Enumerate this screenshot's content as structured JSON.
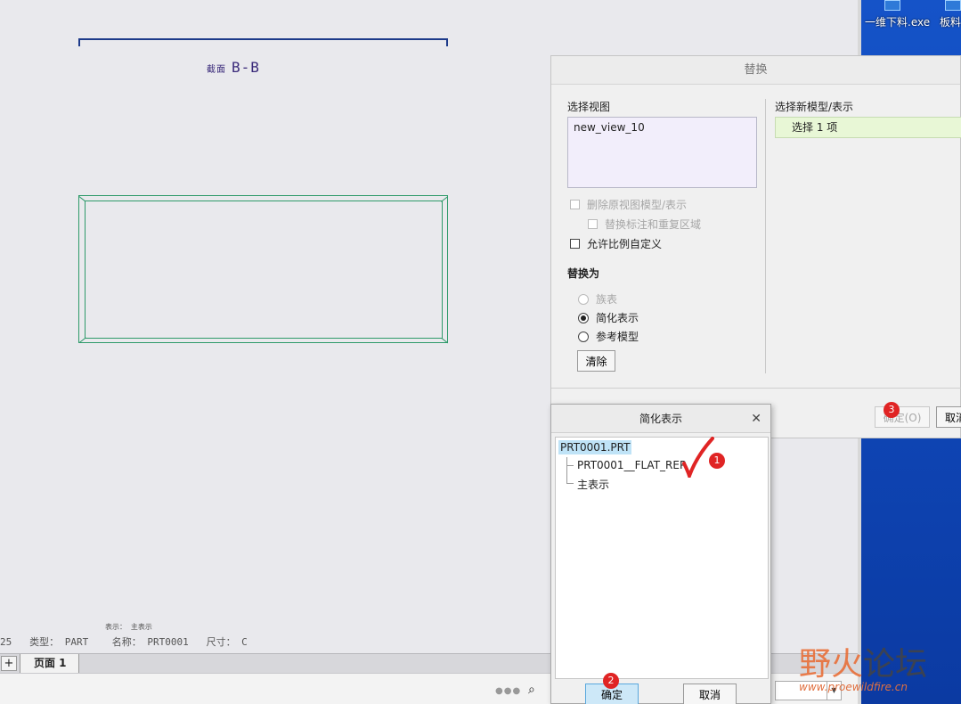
{
  "drawing": {
    "section_prefix": "截面",
    "section_name": "B-B",
    "info_top": "表示： 主表示",
    "info_line": "25   类型： PART    名称： PRT0001   尺寸： C"
  },
  "tabs": {
    "add_label": "+",
    "page_label": "页面 1"
  },
  "statusbar": {
    "dots": "●●●",
    "find_icon": "binoculars-icon"
  },
  "desktop": {
    "icons": [
      {
        "label": "一维下料.exe"
      },
      {
        "label": "板料"
      }
    ],
    "watermark_cn_a": "野火",
    "watermark_cn_b": "论坛",
    "watermark_url": "www.proewildfire.cn"
  },
  "replace_dialog": {
    "title": "替换",
    "select_view_label": "选择视图",
    "view_item": "new_view_10",
    "select_model_label": "选择新模型/表示",
    "select_model_value": "选择 1 项",
    "chk_delete_orig": "删除原视图模型/表示",
    "chk_replace_annot": "替换标注和重复区域",
    "chk_allow_scale": "允许比例自定义",
    "replace_with_label": "替换为",
    "radio_family": "族表",
    "radio_simplified": "简化表示",
    "radio_reference": "参考模型",
    "clear_button": "清除",
    "ok_button": "确定(O)",
    "cancel_button": "取消"
  },
  "simprep_dialog": {
    "title": "简化表示",
    "close_icon": "close-icon",
    "root": "PRT0001.PRT",
    "children": [
      "PRT0001__FLAT_REP",
      "主表示"
    ],
    "ok_button": "确定",
    "cancel_button": "取消"
  },
  "markers": {
    "one": "1",
    "two": "2",
    "three": "3"
  },
  "colors": {
    "annotation_red": "#e02424",
    "part_green": "#2e9a6a",
    "desktop_blue": "#1553c8"
  }
}
